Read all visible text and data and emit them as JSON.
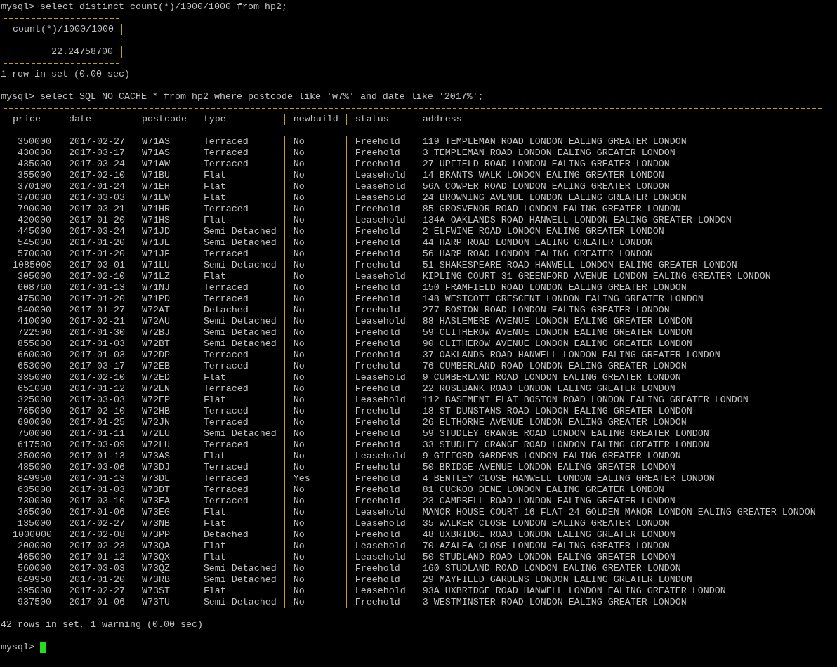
{
  "session": [
    {
      "prompt": "mysql>",
      "command": "select distinct count(*)/1000/1000 from hp2;",
      "result": {
        "columns": [
          {
            "name": "count(*)/1000/1000",
            "numeric": true
          }
        ],
        "rows": [
          [
            "22.24758700"
          ]
        ]
      },
      "summary": "1 row in set (0.00 sec)"
    },
    {
      "prompt": "mysql>",
      "command": "select SQL_NO_CACHE * from hp2 where postcode like 'w7%' and date like '2017%';",
      "result": {
        "columns": [
          {
            "name": "price",
            "numeric": true
          },
          {
            "name": "date"
          },
          {
            "name": "postcode"
          },
          {
            "name": "type"
          },
          {
            "name": "newbuild"
          },
          {
            "name": "status"
          },
          {
            "name": "address"
          }
        ],
        "rows": [
          [
            "350000",
            "2017-02-27",
            "W71AS",
            "Terraced",
            "No",
            "Freehold",
            "119 TEMPLEMAN ROAD LONDON EALING GREATER LONDON"
          ],
          [
            "430000",
            "2017-03-17",
            "W71AS",
            "Terraced",
            "No",
            "Freehold",
            "3 TEMPLEMAN ROAD LONDON EALING GREATER LONDON"
          ],
          [
            "435000",
            "2017-03-24",
            "W71AW",
            "Terraced",
            "No",
            "Freehold",
            "27 UPFIELD ROAD LONDON EALING GREATER LONDON"
          ],
          [
            "355000",
            "2017-02-10",
            "W71BU",
            "Flat",
            "No",
            "Leasehold",
            "14 BRANTS WALK LONDON EALING GREATER LONDON"
          ],
          [
            "370100",
            "2017-01-24",
            "W71EH",
            "Flat",
            "No",
            "Leasehold",
            "56A COWPER ROAD LONDON EALING GREATER LONDON"
          ],
          [
            "370000",
            "2017-03-03",
            "W71EW",
            "Flat",
            "No",
            "Leasehold",
            "24 BROWNING AVENUE LONDON EALING GREATER LONDON"
          ],
          [
            "790000",
            "2017-03-21",
            "W71HR",
            "Terraced",
            "No",
            "Freehold",
            "85 GROSVENOR ROAD LONDON EALING GREATER LONDON"
          ],
          [
            "420000",
            "2017-01-20",
            "W71HS",
            "Flat",
            "No",
            "Leasehold",
            "134A OAKLANDS ROAD HANWELL LONDON EALING GREATER LONDON"
          ],
          [
            "445000",
            "2017-03-24",
            "W71JD",
            "Semi Detached",
            "No",
            "Freehold",
            "2 ELFWINE ROAD LONDON EALING GREATER LONDON"
          ],
          [
            "545000",
            "2017-01-20",
            "W71JE",
            "Semi Detached",
            "No",
            "Freehold",
            "44 HARP ROAD LONDON EALING GREATER LONDON"
          ],
          [
            "570000",
            "2017-01-20",
            "W71JF",
            "Terraced",
            "No",
            "Freehold",
            "56 HARP ROAD LONDON EALING GREATER LONDON"
          ],
          [
            "1085000",
            "2017-03-01",
            "W71LU",
            "Semi Detached",
            "No",
            "Freehold",
            "51 SHAKESPEARE ROAD HANWELL LONDON EALING GREATER LONDON"
          ],
          [
            "305000",
            "2017-02-10",
            "W71LZ",
            "Flat",
            "No",
            "Leasehold",
            "KIPLING COURT 31 GREENFORD AVENUE LONDON EALING GREATER LONDON"
          ],
          [
            "608760",
            "2017-01-13",
            "W71NJ",
            "Terraced",
            "No",
            "Freehold",
            "150 FRAMFIELD ROAD LONDON EALING GREATER LONDON"
          ],
          [
            "475000",
            "2017-01-20",
            "W71PD",
            "Terraced",
            "No",
            "Freehold",
            "148 WESTCOTT CRESCENT LONDON EALING GREATER LONDON"
          ],
          [
            "940000",
            "2017-01-27",
            "W72AT",
            "Detached",
            "No",
            "Freehold",
            "277 BOSTON ROAD LONDON EALING GREATER LONDON"
          ],
          [
            "410000",
            "2017-02-21",
            "W72AU",
            "Semi Detached",
            "No",
            "Leasehold",
            "88 HASLEMERE AVENUE LONDON EALING GREATER LONDON"
          ],
          [
            "722500",
            "2017-01-30",
            "W72BJ",
            "Semi Detached",
            "No",
            "Freehold",
            "59 CLITHEROW AVENUE LONDON EALING GREATER LONDON"
          ],
          [
            "855000",
            "2017-01-03",
            "W72BT",
            "Semi Detached",
            "No",
            "Freehold",
            "90 CLITHEROW AVENUE LONDON EALING GREATER LONDON"
          ],
          [
            "660000",
            "2017-01-03",
            "W72DP",
            "Terraced",
            "No",
            "Freehold",
            "37 OAKLANDS ROAD HANWELL LONDON EALING GREATER LONDON"
          ],
          [
            "653000",
            "2017-03-17",
            "W72EB",
            "Terraced",
            "No",
            "Freehold",
            "76 CUMBERLAND ROAD LONDON EALING GREATER LONDON"
          ],
          [
            "385000",
            "2017-02-10",
            "W72ED",
            "Flat",
            "No",
            "Leasehold",
            "9 CUMBERLAND ROAD LONDON EALING GREATER LONDON"
          ],
          [
            "651000",
            "2017-01-12",
            "W72EN",
            "Terraced",
            "No",
            "Freehold",
            "22 ROSEBANK ROAD LONDON EALING GREATER LONDON"
          ],
          [
            "325000",
            "2017-03-03",
            "W72EP",
            "Flat",
            "No",
            "Leasehold",
            "112 BASEMENT FLAT BOSTON ROAD LONDON EALING GREATER LONDON"
          ],
          [
            "765000",
            "2017-02-10",
            "W72HB",
            "Terraced",
            "No",
            "Freehold",
            "18 ST DUNSTANS ROAD LONDON EALING GREATER LONDON"
          ],
          [
            "690000",
            "2017-01-25",
            "W72JN",
            "Terraced",
            "No",
            "Freehold",
            "26 ELTHORNE AVENUE LONDON EALING GREATER LONDON"
          ],
          [
            "750000",
            "2017-01-11",
            "W72LU",
            "Semi Detached",
            "No",
            "Freehold",
            "59 STUDLEY GRANGE ROAD LONDON EALING GREATER LONDON"
          ],
          [
            "617500",
            "2017-03-09",
            "W72LU",
            "Terraced",
            "No",
            "Freehold",
            "33 STUDLEY GRANGE ROAD LONDON EALING GREATER LONDON"
          ],
          [
            "350000",
            "2017-01-13",
            "W73AS",
            "Flat",
            "No",
            "Leasehold",
            "9 GIFFORD GARDENS LONDON EALING GREATER LONDON"
          ],
          [
            "485000",
            "2017-03-06",
            "W73DJ",
            "Terraced",
            "No",
            "Freehold",
            "50 BRIDGE AVENUE LONDON EALING GREATER LONDON"
          ],
          [
            "849950",
            "2017-01-13",
            "W73DL",
            "Terraced",
            "Yes",
            "Freehold",
            "4 BENTLEY CLOSE HANWELL LONDON EALING GREATER LONDON"
          ],
          [
            "635000",
            "2017-01-03",
            "W73DT",
            "Terraced",
            "No",
            "Freehold",
            "81 CUCKOO DENE LONDON EALING GREATER LONDON"
          ],
          [
            "730000",
            "2017-03-10",
            "W73EA",
            "Terraced",
            "No",
            "Freehold",
            "23 CAMPBELL ROAD LONDON EALING GREATER LONDON"
          ],
          [
            "365000",
            "2017-01-06",
            "W73EG",
            "Flat",
            "No",
            "Leasehold",
            "MANOR HOUSE COURT 16 FLAT 24 GOLDEN MANOR LONDON EALING GREATER LONDON"
          ],
          [
            "135000",
            "2017-02-27",
            "W73NB",
            "Flat",
            "No",
            "Leasehold",
            "35 WALKER CLOSE LONDON EALING GREATER LONDON"
          ],
          [
            "1000000",
            "2017-02-08",
            "W73PP",
            "Detached",
            "No",
            "Freehold",
            "48 UXBRIDGE ROAD LONDON EALING GREATER LONDON"
          ],
          [
            "200000",
            "2017-02-23",
            "W73QA",
            "Flat",
            "No",
            "Leasehold",
            "70 AZALEA CLOSE LONDON EALING GREATER LONDON"
          ],
          [
            "465000",
            "2017-01-12",
            "W73QX",
            "Flat",
            "No",
            "Leasehold",
            "50 STUDLAND ROAD LONDON EALING GREATER LONDON"
          ],
          [
            "560000",
            "2017-03-03",
            "W73QZ",
            "Semi Detached",
            "No",
            "Freehold",
            "160 STUDLAND ROAD LONDON EALING GREATER LONDON"
          ],
          [
            "649950",
            "2017-01-20",
            "W73RB",
            "Semi Detached",
            "No",
            "Freehold",
            "29 MAYFIELD GARDENS LONDON EALING GREATER LONDON"
          ],
          [
            "395000",
            "2017-02-27",
            "W73ST",
            "Flat",
            "No",
            "Leasehold",
            "93A UXBRIDGE ROAD HANWELL LONDON EALING GREATER LONDON"
          ],
          [
            "937500",
            "2017-01-06",
            "W73TU",
            "Semi Detached",
            "No",
            "Freehold",
            "3 WESTMINSTER ROAD LONDON EALING GREATER LONDON"
          ]
        ]
      },
      "summary": "42 rows in set, 1 warning (0.00 sec)"
    }
  ],
  "current_prompt": "mysql>"
}
